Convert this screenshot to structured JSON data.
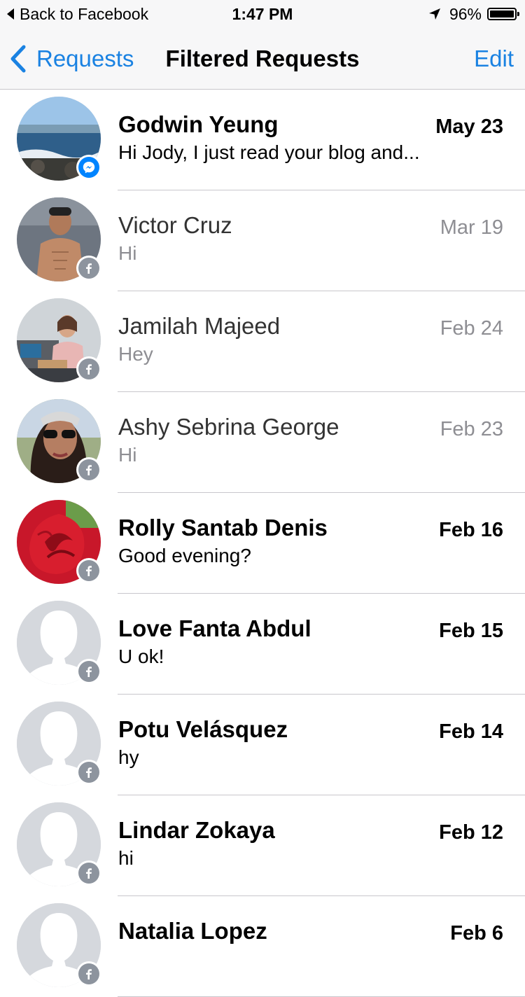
{
  "status_bar": {
    "back_label": "Back to Facebook",
    "time": "1:47 PM",
    "battery": "96%"
  },
  "nav": {
    "back_label": "Requests",
    "title": "Filtered Requests",
    "edit_label": "Edit"
  },
  "colors": {
    "accent": "#1a82e2",
    "messenger_badge": "#0084ff",
    "facebook_badge": "#8d949e",
    "separator": "#c8c7cc"
  },
  "threads": [
    {
      "name": "Godwin Yeung",
      "preview": "Hi Jody, I just read your blog and...",
      "date": "May 23",
      "unread": true,
      "badge": "messenger-icon"
    },
    {
      "name": "Victor Cruz",
      "preview": "Hi",
      "date": "Mar 19",
      "unread": false,
      "badge": "facebook-icon"
    },
    {
      "name": "Jamilah Majeed",
      "preview": "Hey",
      "date": "Feb 24",
      "unread": false,
      "badge": "facebook-icon"
    },
    {
      "name": "Ashy Sebrina George",
      "preview": "Hi",
      "date": "Feb 23",
      "unread": false,
      "badge": "facebook-icon"
    },
    {
      "name": "Rolly Santab Denis",
      "preview": "Good evening?",
      "date": "Feb 16",
      "unread": true,
      "badge": "facebook-icon"
    },
    {
      "name": "Love Fanta Abdul",
      "preview": "U ok!",
      "date": "Feb 15",
      "unread": true,
      "badge": "facebook-icon"
    },
    {
      "name": "Potu Velásquez",
      "preview": "hy",
      "date": "Feb 14",
      "unread": true,
      "badge": "facebook-icon"
    },
    {
      "name": "Lindar Zokaya",
      "preview": "hi",
      "date": "Feb 12",
      "unread": true,
      "badge": "facebook-icon"
    },
    {
      "name": "Natalia Lopez",
      "preview": "",
      "date": "Feb 6",
      "unread": true,
      "badge": "facebook-icon"
    }
  ]
}
